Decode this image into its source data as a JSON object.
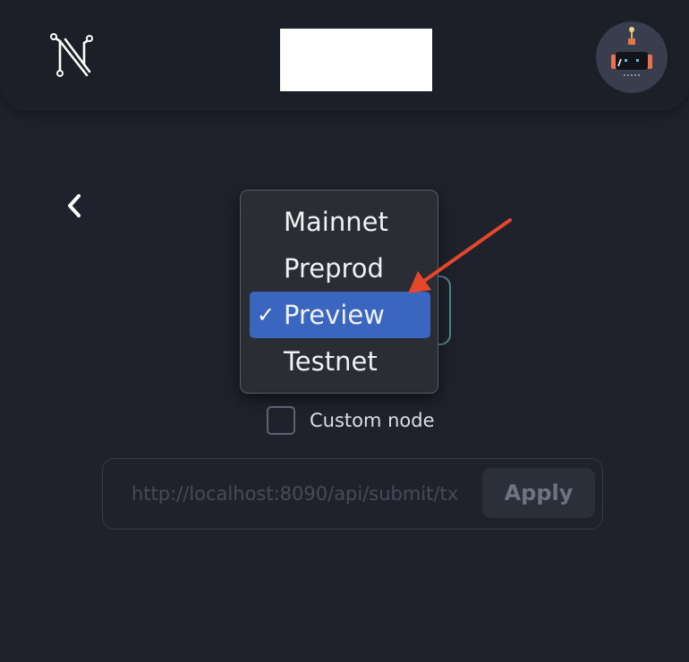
{
  "header": {
    "logo_icon": "n-circuit-logo-icon",
    "avatar_icon": "robot-avatar-icon"
  },
  "navigation": {
    "back_icon": "chevron-left-icon"
  },
  "network_dropdown": {
    "options": [
      "Mainnet",
      "Preprod",
      "Preview",
      "Testnet"
    ],
    "selected": "Preview",
    "check_glyph": "✓",
    "selected_color": "#3a66c0"
  },
  "custom_node": {
    "label": "Custom node",
    "checked": false
  },
  "node_url": {
    "placeholder": "http://localhost:8090/api/submit/tx",
    "value": ""
  },
  "apply_button": {
    "label": "Apply"
  },
  "annotation": {
    "icon": "red-arrow-icon",
    "color": "#e5472b"
  }
}
